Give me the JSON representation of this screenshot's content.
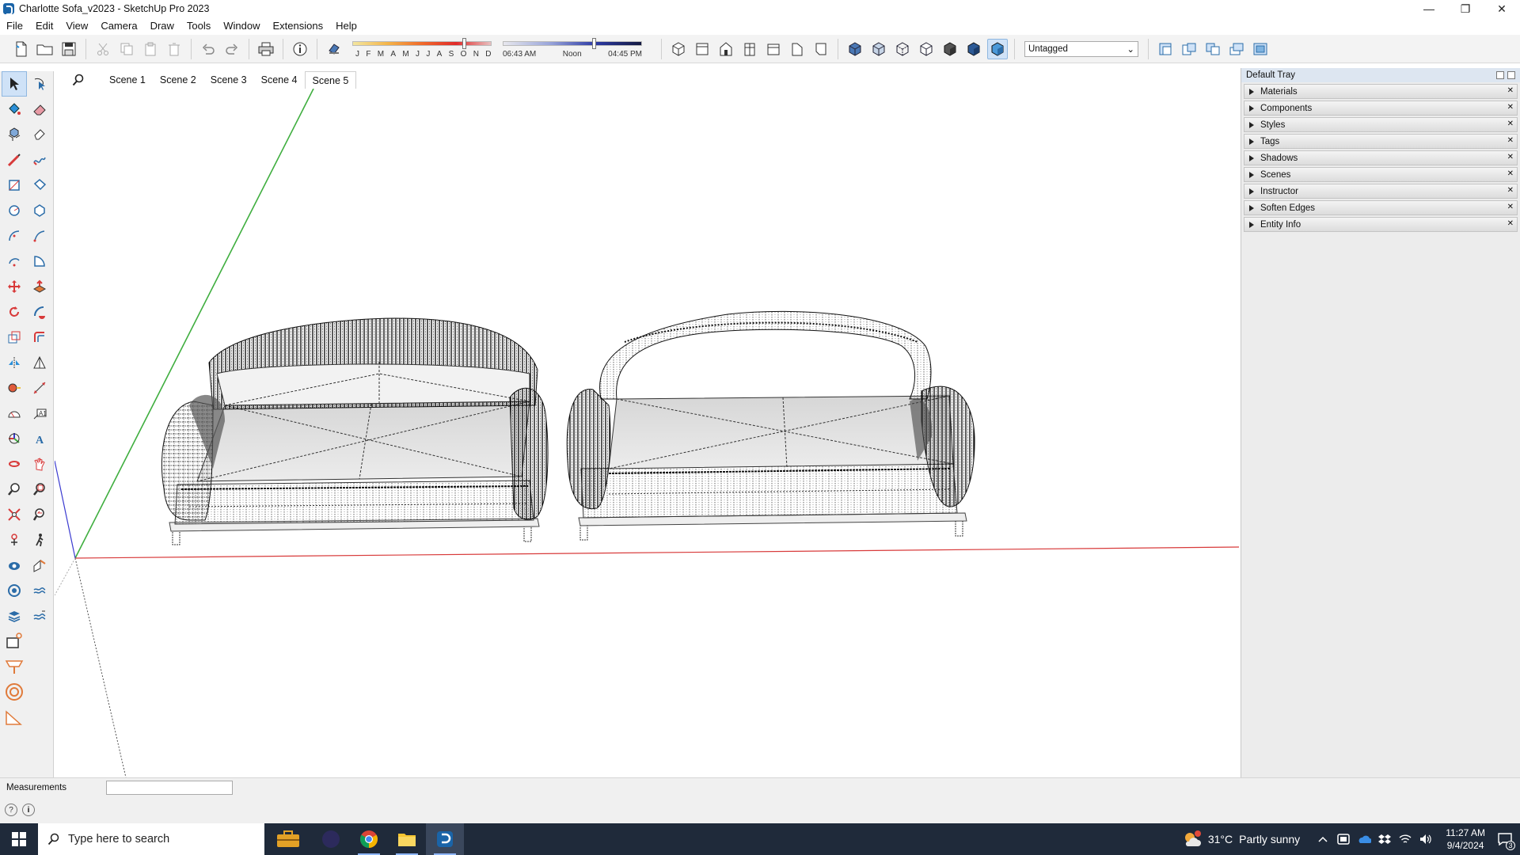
{
  "window": {
    "title": "Charlotte Sofa_v2023 - SketchUp Pro 2023",
    "minimize": "—",
    "maximize": "❐",
    "close": "✕"
  },
  "menu": [
    "File",
    "Edit",
    "View",
    "Camera",
    "Draw",
    "Tools",
    "Window",
    "Extensions",
    "Help"
  ],
  "shadow": {
    "months": [
      "J",
      "F",
      "M",
      "A",
      "M",
      "J",
      "J",
      "A",
      "S",
      "O",
      "N",
      "D"
    ],
    "time_start": "06:43 AM",
    "time_mid": "Noon",
    "time_end": "04:45 PM"
  },
  "tag_select": {
    "value": "Untagged",
    "arrow": "⌄"
  },
  "scenes": {
    "tabs": [
      "Scene 1",
      "Scene 2",
      "Scene 3",
      "Scene 4",
      "Scene 5"
    ],
    "active": "Scene 5"
  },
  "tray": {
    "title": "Default Tray",
    "panels": [
      "Materials",
      "Components",
      "Styles",
      "Tags",
      "Shadows",
      "Scenes",
      "Instructor",
      "Soften Edges",
      "Entity Info"
    ]
  },
  "measurements": {
    "label": "Measurements",
    "value": ""
  },
  "taskbar": {
    "search_placeholder": "Type here to search",
    "weather_temp": "31°C",
    "weather_desc": "Partly sunny",
    "weather_badge": "1",
    "time": "11:27 AM",
    "date": "9/4/2024",
    "notifications": "3"
  },
  "colors": {
    "axis_red": "#d83a3a",
    "axis_green": "#3fae3f",
    "axis_blue": "#3a3ad0",
    "taskbar": "#1f2a3a",
    "tray_header": "#dde6f1"
  }
}
